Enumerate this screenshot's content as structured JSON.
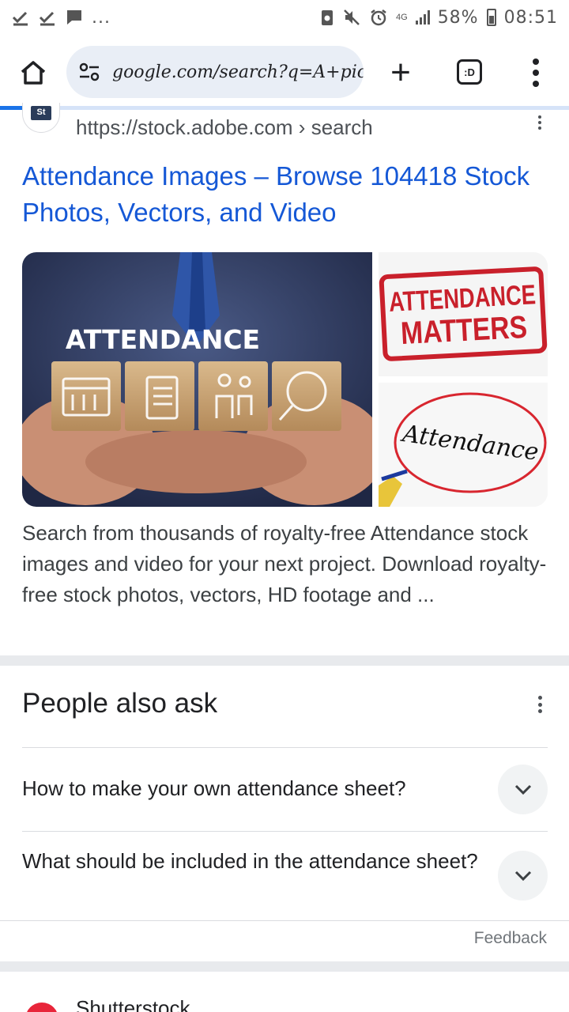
{
  "status_bar": {
    "left_icons": [
      "check-icon",
      "check-icon",
      "message-icon"
    ],
    "ellipsis": "...",
    "network": "4G",
    "battery": "58%",
    "time": "08:51"
  },
  "toolbar": {
    "url": "google.com/search?q=A+pic",
    "tab_count": ":D"
  },
  "result": {
    "favicon_text": "St",
    "site_url": "https://stock.adobe.com › search",
    "title": "Attendance Images – Browse 104418 Stock Photos, Vectors, and Video",
    "snippet": "Search from thousands of royalty-free Attendance stock images and video for your next project. Download royalty-free stock photos, vectors, HD footage and ...",
    "images": {
      "main_caption": "ATTENDANCE",
      "stamp_line1": "ATTENDANCE",
      "stamp_line2": "MATTERS",
      "circle_word": "Attendance"
    }
  },
  "people_also_ask": {
    "title": "People also ask",
    "questions": [
      "How to make your own attendance sheet?",
      "What should be included in the attendance sheet?"
    ],
    "feedback": "Feedback"
  },
  "next_result": {
    "site_name": "Shutterstock"
  },
  "colors": {
    "link": "#1558d6",
    "omnibox_bg": "#e9eef6",
    "progress": "#1a73e8",
    "separator": "#e8eaed"
  }
}
